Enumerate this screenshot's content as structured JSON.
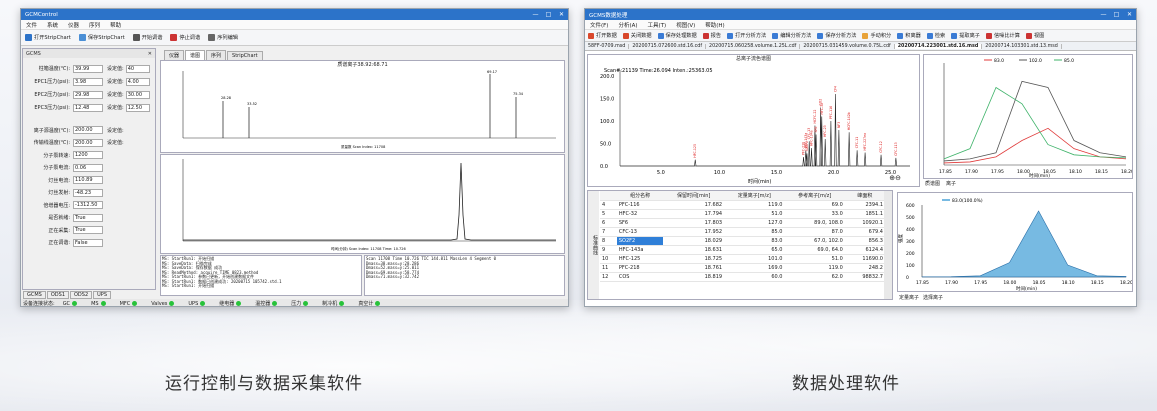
{
  "left": {
    "title": "GCMControl",
    "menu": [
      "文件",
      "系统",
      "仪器",
      "序列",
      "帮助"
    ],
    "toolbar": [
      "打开StripChart",
      "保存StripChart",
      "开始调谐",
      "停止调谐",
      "序列编辑"
    ],
    "panel_title": "GCMS",
    "params": [
      {
        "label": "柱箱温度(℃):",
        "value": "39.99",
        "set_label": "设定值:",
        "set_value": "40"
      },
      {
        "label": "EPC1压力(psi):",
        "value": "3.98",
        "set_label": "设定值:",
        "set_value": "4.00"
      },
      {
        "label": "EPC2压力(psi):",
        "value": "29.98",
        "set_label": "设定值:",
        "set_value": "30.00"
      },
      {
        "label": "EPC3压力(psi):",
        "value": "12.48",
        "set_label": "设定值:",
        "set_value": "12.50"
      }
    ],
    "params2": [
      {
        "label": "离子源温度(℃):",
        "value": "200.00",
        "set_label": "设定值:"
      },
      {
        "label": "传输线温度(℃):",
        "value": "200.00",
        "set_label": "设定值:"
      },
      {
        "label": "分子泵转速:",
        "value": "1200"
      },
      {
        "label": "分子泵电流:",
        "value": "0.06"
      },
      {
        "label": "灯丝电流:",
        "value": "110.89"
      },
      {
        "label": "灯丝发射:",
        "value": "-48.23"
      },
      {
        "label": "倍增器电压:",
        "value": "-1312.50"
      },
      {
        "label": "是否就绪:",
        "value": "True"
      },
      {
        "label": "正在采集:",
        "value": "True"
      },
      {
        "label": "正在调谐:",
        "value": "False"
      }
    ],
    "chart_tabs": [
      "仪器",
      "谱图",
      "序列",
      "StripChart"
    ],
    "ms_title": "质谱离子38.92:68.71",
    "ms_xlabel": "质量数 Scan Index: 11708",
    "ms_ylabel": "强度 TIC",
    "tic_xlabel": "时间(分钟) Scan Index: 11708 Time: 10.726",
    "tic_ylabel": "TIC",
    "peak_labels": [
      "28.28",
      "33.52",
      "69.17",
      "75.34"
    ],
    "log_left": [
      "MS: StartRun1: 开始扫描",
      "MS: SaveData: 扫描完成",
      "MS: SaveData: 保存数据 成功",
      "MS: ReadMethod: acquire_TIME_0823.method",
      "MS: StartRun1: 参数已更新，开始创建数据文件",
      "MS: StartRun1: 数据已创建成功: 20200715 105742.std.1",
      "MS: StartRun1: 开始扫描"
    ],
    "log_right": [
      "Scan 11708 Time 10.726 TIC 144.811 MassLen 4 Segment 0",
      "  Dmass=38.mass=y:28.286",
      "  Dmass=52.mass=y:25.011",
      "  Dmass=69.mass=y:58.774",
      "  Dmass=71.mass=y:32.742"
    ],
    "bottom_tabs": [
      "GCMS",
      "ODS1",
      "ODS2",
      "UPS"
    ],
    "status_label": "设备连接状态:",
    "status_items": [
      "GC",
      "MS",
      "MFC",
      "Valves",
      "UPS",
      "继电器",
      "温控器",
      "压力",
      "制冷机",
      "真空计"
    ]
  },
  "right": {
    "title": "GCMS数据处理",
    "menu": [
      "文件(F)",
      "分析(A)",
      "工具(T)",
      "视图(V)",
      "帮助(H)"
    ],
    "toolbar": [
      "打开数据",
      "关闭数据",
      "保存处理数据",
      "报告",
      "打开分析方法",
      "编辑分析方法",
      "保存分析方法",
      "手动积分",
      "积离器",
      "检索",
      "提取离子",
      "信噪比计算",
      "视图"
    ],
    "file_tabs": [
      "58FF-0709.msd",
      "20200715.072600.std.16.cdf",
      "20200715.060258.volume.1.25L.cdf",
      "20200715.031459.volume.0.75L.cdf",
      "20200714.223001.std.16.msd",
      "20200714.103301.std.13.msd"
    ],
    "chrom_title": "总离子流色谱图",
    "scan_info": "Scan#:21139  Time:26.094  Inten.:25363.05",
    "chrom_xlabel": "时间(min)",
    "chrom_ylabel": "强度(10^3)",
    "peak_marks": [
      "HFC-125",
      "PFC-218",
      "HFC-143a",
      "SO2F2",
      "CFC-13",
      "HFC-134a",
      "HCFC-22",
      "SF6",
      "CO2",
      "HFC-32",
      "HFC-23",
      "PFC-116",
      "CF4",
      "NF3",
      "HCFC-142b",
      "CFC-11",
      "HFC-227ea",
      "CFC-12",
      "CFC-113"
    ],
    "table_headers": [
      "",
      "组分名称",
      "保留时间[min]",
      "定量离子[m/z]",
      "参考离子[m/z]",
      "峰面积"
    ],
    "table_rows": [
      [
        "4",
        "PFC-116",
        "17.682",
        "119.0",
        "69.0",
        "2394.1"
      ],
      [
        "5",
        "HFC-32",
        "17.794",
        "51.0",
        "33.0",
        "1851.1"
      ],
      [
        "6",
        "SF6",
        "17.803",
        "127.0",
        "89.0, 108.0",
        "10920.1"
      ],
      [
        "7",
        "CFC-13",
        "17.952",
        "85.0",
        "87.0",
        "679.4"
      ],
      [
        "8",
        "SO2F2",
        "18.029",
        "83.0",
        "67.0, 102.0",
        "856.3"
      ],
      [
        "9",
        "HFC-143a",
        "18.631",
        "65.0",
        "69.0, 64.0",
        "6124.4"
      ],
      [
        "10",
        "HFC-125",
        "18.725",
        "101.0",
        "51.0",
        "11690.0"
      ],
      [
        "11",
        "PFC-218",
        "18.761",
        "169.0",
        "119.0",
        "248.2"
      ],
      [
        "12",
        "COS",
        "18.819",
        "60.0",
        "62.0",
        "98832.7"
      ]
    ],
    "side_tab": "标准曲线",
    "eic_tabs": [
      "质谱图",
      "离子"
    ],
    "eic_legend": [
      "83.0",
      "102.0",
      "85.0"
    ],
    "eic_xlabel": "时间(min)",
    "int_legend": "83.0(100.0%)",
    "int_xlabel": "时间(min)",
    "int_ylabel": "强度",
    "int_tabs": [
      "定量离子",
      "选择离子"
    ]
  },
  "captions": {
    "left": "运行控制与数据采集软件",
    "right": "数据处理软件"
  },
  "colors": {
    "titlebar": "#2c73c9",
    "status_ok": "#28c23a",
    "eic1": "#e03a3a",
    "eic2": "#555555",
    "eic3": "#3fb36a",
    "area_fill": "#4aa3d8"
  },
  "chart_data": [
    {
      "type": "line",
      "xlabel": "时间(min)",
      "x": [
        17.85,
        17.9,
        17.95,
        18,
        18.05,
        18.1,
        18.15,
        18.2
      ],
      "series": [
        {
          "name": "83.0",
          "values": [
            10,
            15,
            40,
            120,
            180,
            80,
            40,
            30
          ]
        },
        {
          "name": "102.0",
          "values": [
            20,
            30,
            60,
            410,
            380,
            120,
            60,
            40
          ]
        },
        {
          "name": "85.0",
          "values": [
            30,
            80,
            380,
            300,
            100,
            50,
            40,
            35
          ]
        }
      ],
      "ylim": [
        0,
        500
      ]
    },
    {
      "type": "area",
      "xlabel": "时间(min)",
      "ylabel": "强度",
      "x": [
        17.85,
        17.9,
        17.95,
        18,
        18.05,
        18.1,
        18.15,
        18.2
      ],
      "series": [
        {
          "name": "83.0(100.0%)",
          "values": [
            2,
            3,
            10,
            120,
            550,
            100,
            10,
            5
          ]
        }
      ],
      "ylim": [
        0,
        600
      ]
    }
  ]
}
